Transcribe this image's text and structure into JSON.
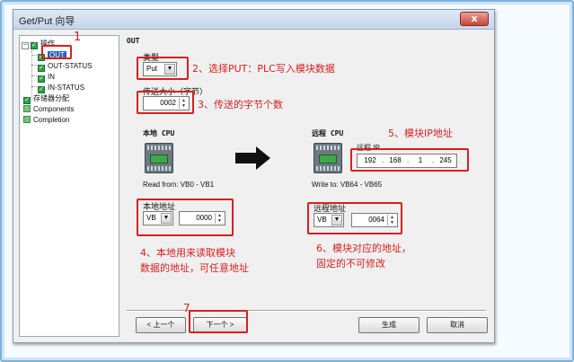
{
  "window": {
    "title": "Get/Put 向导",
    "close_label": "x"
  },
  "tree": {
    "items": [
      {
        "label": "操作",
        "checked": true,
        "expander": "−"
      },
      {
        "label": "OUT",
        "checked": true,
        "selected": true
      },
      {
        "label": "OUT-STATUS",
        "checked": true
      },
      {
        "label": "IN",
        "checked": true
      },
      {
        "label": "IN-STATUS",
        "checked": true
      },
      {
        "label": "存储器分配",
        "checked": true
      },
      {
        "label": "Components",
        "checked": false
      },
      {
        "label": "Completion",
        "checked": false
      }
    ]
  },
  "panel": {
    "title": "OUT",
    "type_label": "类型",
    "type_value": "Put",
    "size_label": "传送大小（字节）",
    "size_value": "0002",
    "local_cpu_label": "本地 CPU",
    "remote_cpu_label": "远程 CPU",
    "remote_ip_label": "远程 IP",
    "ip": [
      "192",
      "168",
      "1",
      "245"
    ],
    "read_from": "Read from: VB0 - VB1",
    "write_to": "Write to: VB64 - VB65",
    "local_addr_label": "本地地址",
    "local_area": "VB",
    "local_addr_value": "0000",
    "remote_addr_label": "远程地址",
    "remote_area": "VB",
    "remote_addr_value": "0064"
  },
  "buttons": {
    "prev": "< 上一个",
    "next": "下一个 >",
    "generate": "生成",
    "cancel": "取消"
  },
  "annotations": {
    "n1": "1",
    "n2": "2、选择PUT：PLC写入模块数据",
    "n3": "3、传送的字节个数",
    "n4a": "4、本地用来读取模块",
    "n4b": "数据的地址，可任意地址",
    "n5": "5、模块IP地址",
    "n6a": "6、模块对应的地址，",
    "n6b": "固定的不可修改",
    "n7": "7"
  },
  "colors": {
    "annotation": "#d62020",
    "window_frame": "#7bb3e0"
  }
}
